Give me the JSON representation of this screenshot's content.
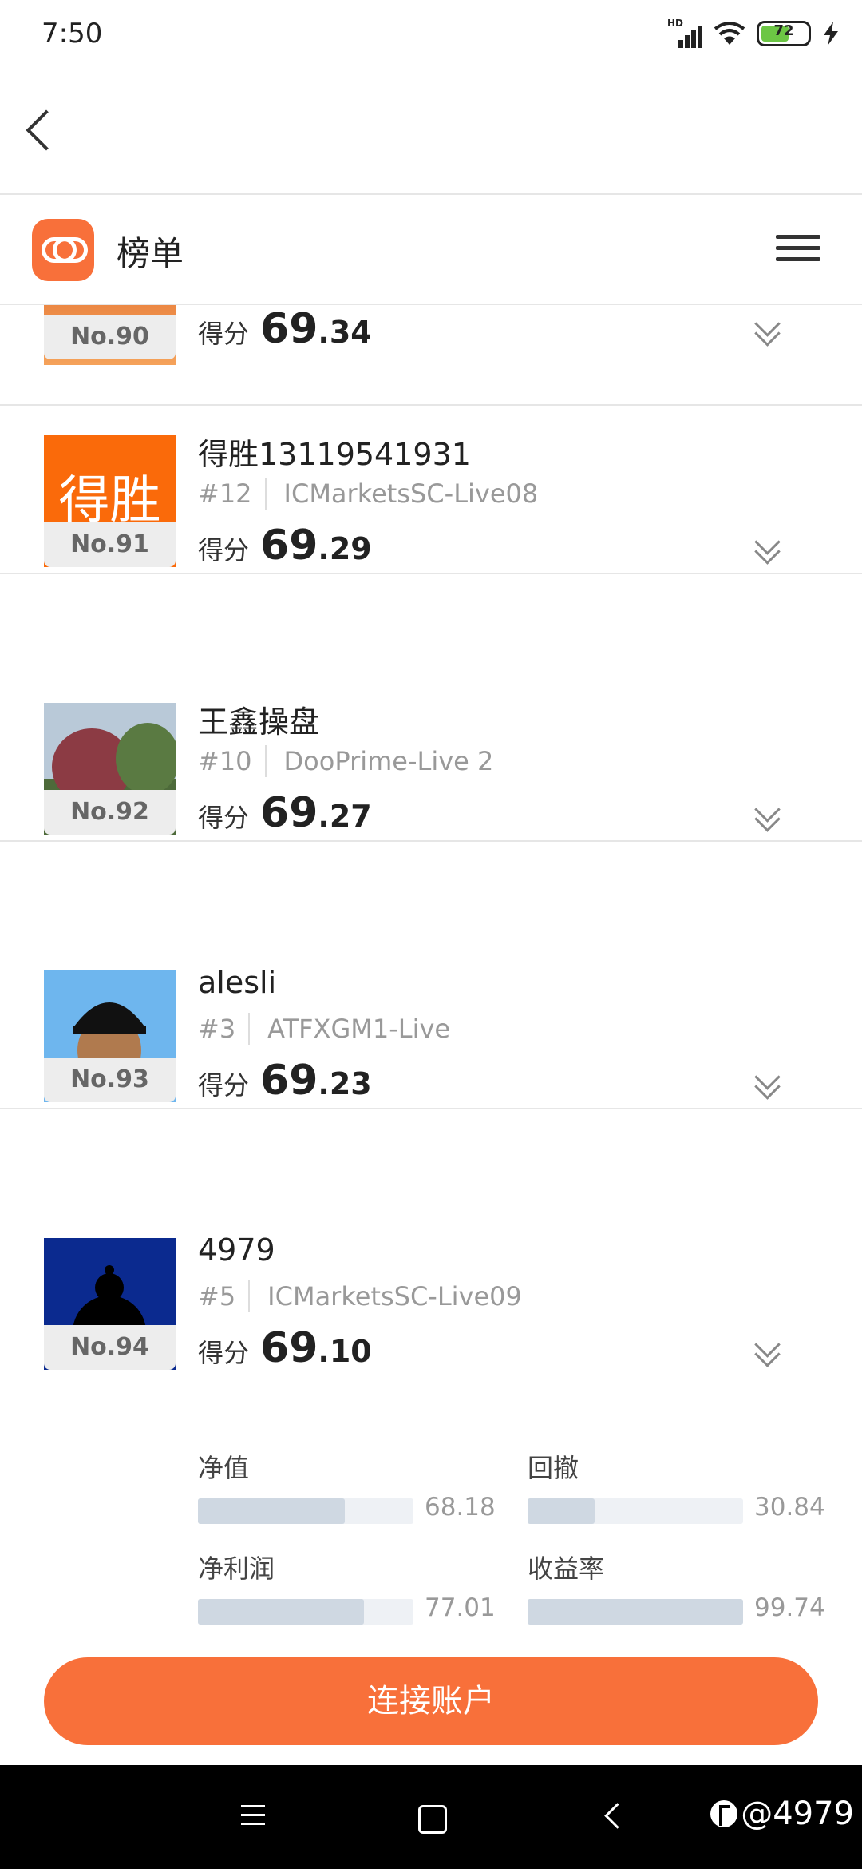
{
  "status": {
    "time": "7:50",
    "signal_tag": "HD",
    "battery": "72"
  },
  "app": {
    "title": "榜单"
  },
  "score_label": "得分",
  "entries": [
    {
      "badge": "No.90",
      "score_int": "69",
      "score_dec": ".34"
    },
    {
      "badge": "No.91",
      "name": "得胜13119541931",
      "rank": "#12",
      "server": "ICMarketsSC-Live08",
      "score_int": "69",
      "score_dec": ".29",
      "avatar_text": "得胜"
    },
    {
      "badge": "No.92",
      "name": "王鑫操盘",
      "rank": "#10",
      "server": "DooPrime-Live 2",
      "score_int": "69",
      "score_dec": ".27"
    },
    {
      "badge": "No.93",
      "name": "alesli",
      "rank": "#3",
      "server": "ATFXGM1-Live",
      "score_int": "69",
      "score_dec": ".23"
    },
    {
      "badge": "No.94",
      "name": "4979",
      "rank": "#5",
      "server": "ICMarketsSC-Live09",
      "score_int": "69",
      "score_dec": ".10"
    }
  ],
  "metrics": [
    {
      "label": "净值",
      "value": "68.18",
      "fill_pct": 68
    },
    {
      "label": "回撤",
      "value": "30.84",
      "fill_pct": 31
    },
    {
      "label": "净利润",
      "value": "77.01",
      "fill_pct": 77
    },
    {
      "label": "收益率",
      "value": "99.74",
      "fill_pct": 100
    }
  ],
  "cta_label": "连接账户",
  "watermark": "@4979",
  "colors": {
    "accent": "#f8703a"
  }
}
